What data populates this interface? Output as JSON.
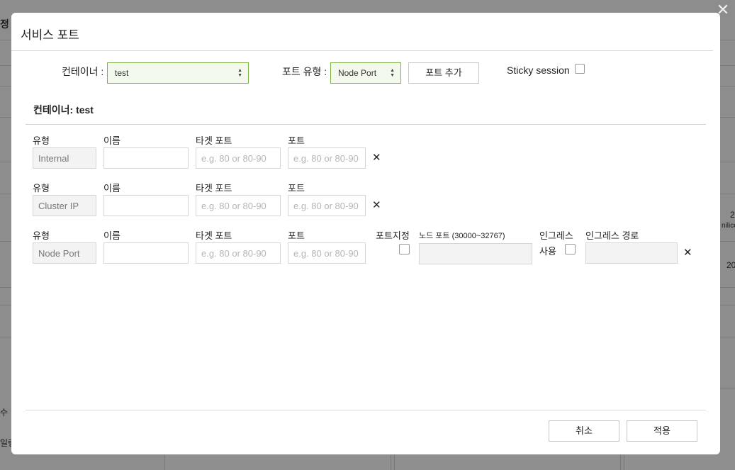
{
  "background": {
    "frag1": "정",
    "frag2": "수",
    "frag3": "일링",
    "frag4": "2",
    "frag5": "nilico",
    "frag6": "20"
  },
  "dialog": {
    "title": "서비스 포트",
    "close_glyph": "✕"
  },
  "toolbar": {
    "container_label": "컨테이너 :",
    "container_value": "test",
    "port_type_label": "포트 유형 :",
    "port_type_value": "Node Port",
    "add_port_label": "포트 추가",
    "sticky_label": "Sticky session"
  },
  "section": {
    "title": "컨테이너: test"
  },
  "columns": {
    "type": "유형",
    "name": "이름",
    "target_port": "타겟 포트",
    "port": "포트",
    "port_assign": "포트지정",
    "node_port": "노드 포트 (30000~32767)",
    "ingress_use_1": "인그레스",
    "ingress_use_2": "사용",
    "ingress_path": "인그레스 경로"
  },
  "rows": [
    {
      "type": "Internal",
      "name": "",
      "target_placeholder": "e.g. 80 or 80-90",
      "port_placeholder": "e.g. 80 or 80-90"
    },
    {
      "type": "Cluster IP",
      "name": "",
      "target_placeholder": "e.g. 80 or 80-90",
      "port_placeholder": "e.g. 80 or 80-90"
    },
    {
      "type": "Node Port",
      "name": "",
      "target_placeholder": "e.g. 80 or 80-90",
      "port_placeholder": "e.g. 80 or 80-90"
    }
  ],
  "remove_glyph": "✕",
  "footer": {
    "cancel_label": "취소",
    "apply_label": "적용"
  }
}
